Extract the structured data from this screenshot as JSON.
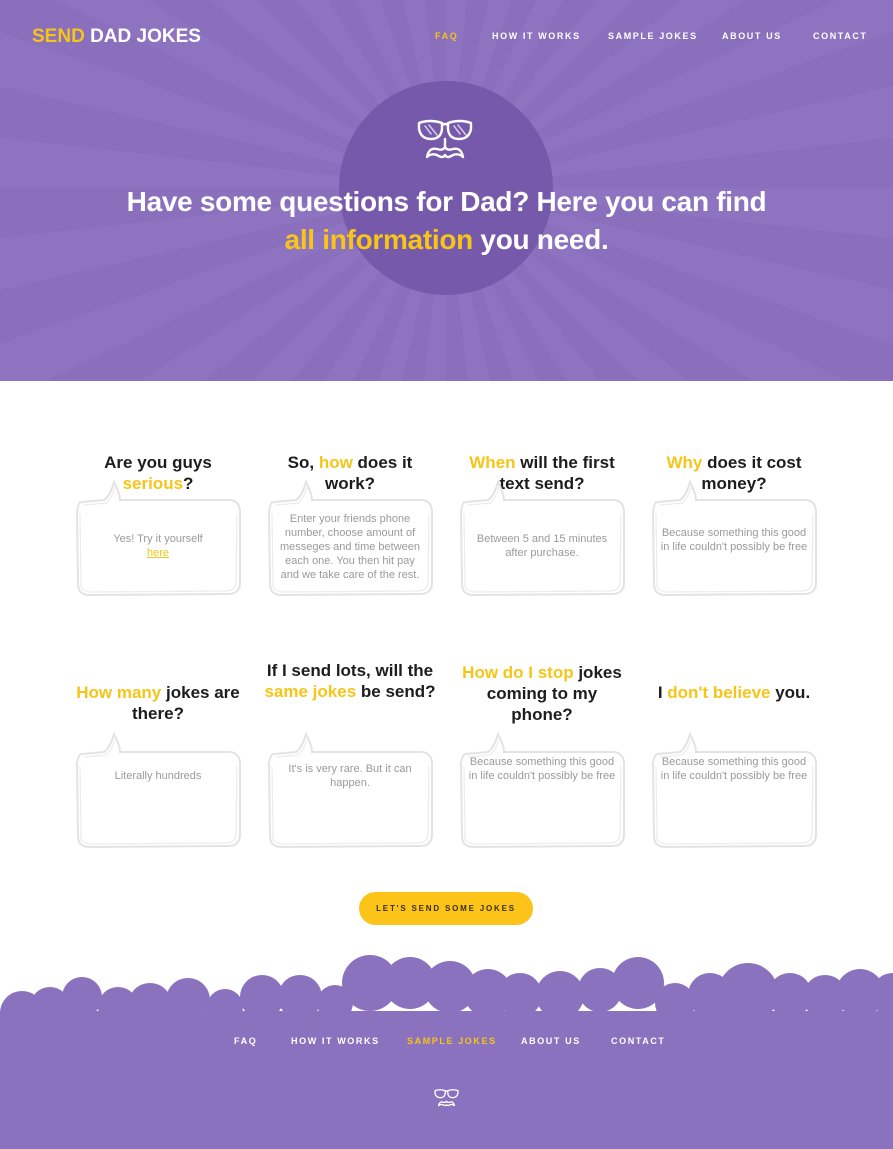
{
  "brand": {
    "accent_word": "SEND",
    "rest": "DAD JOKES"
  },
  "nav": {
    "items": [
      {
        "label": "FAQ",
        "active": true
      },
      {
        "label": "HOW IT WORKS",
        "active": false
      },
      {
        "label": "SAMPLE JOKES",
        "active": false
      },
      {
        "label": "ABOUT US",
        "active": false
      },
      {
        "label": "CONTACT",
        "active": false
      }
    ]
  },
  "hero": {
    "line1": "Have some questions for Dad? Here you can find",
    "line2_accent": "all information",
    "line2_rest": " you need."
  },
  "faq": [
    {
      "q_pre": "Are you guys ",
      "q_accent": "serious",
      "q_post": "?",
      "answer": "Yes! Try it yourself",
      "link": "here"
    },
    {
      "q_pre": "So, ",
      "q_accent": "how",
      "q_post": " does it work?",
      "answer": "Enter your friends phone number, choose amount of messeges and time between each one.  You then hit pay and we take care of the rest."
    },
    {
      "q_pre": "",
      "q_accent": "When",
      "q_post": " will the first text send?",
      "answer": "Between 5 and 15 minutes after purchase."
    },
    {
      "q_pre": "",
      "q_accent": "Why",
      "q_post": "  does it cost money?",
      "answer": "Because something this good in life couldn't possibly be free"
    },
    {
      "q_pre": "",
      "q_accent": "How many",
      "q_post": " jokes are there?",
      "answer": "Literally hundreds"
    },
    {
      "q_pre": "If I send lots, will the ",
      "q_accent": "same jokes",
      "q_post": " be send?",
      "answer": "It's is very rare. But it can happen."
    },
    {
      "q_pre": "",
      "q_accent": "How do I stop",
      "q_post": " jokes coming to my phone?",
      "answer": "Because something this good in life couldn't possibly be free"
    },
    {
      "q_pre": "I ",
      "q_accent": "don't believe",
      "q_post": " you.",
      "answer": "Because something this good in life couldn't possibly be free"
    }
  ],
  "cta": {
    "label": "LET'S SEND SOME JOKES"
  },
  "footer": {
    "items": [
      {
        "label": "FAQ",
        "active": false
      },
      {
        "label": "HOW IT WORKS",
        "active": false
      },
      {
        "label": "SAMPLE JOKES",
        "active": true
      },
      {
        "label": "ABOUT US",
        "active": false
      },
      {
        "label": "CONTACT",
        "active": false
      }
    ]
  },
  "colors": {
    "purple": "#8a6fbc",
    "accent": "#f5c518",
    "button": "#fcc419"
  }
}
